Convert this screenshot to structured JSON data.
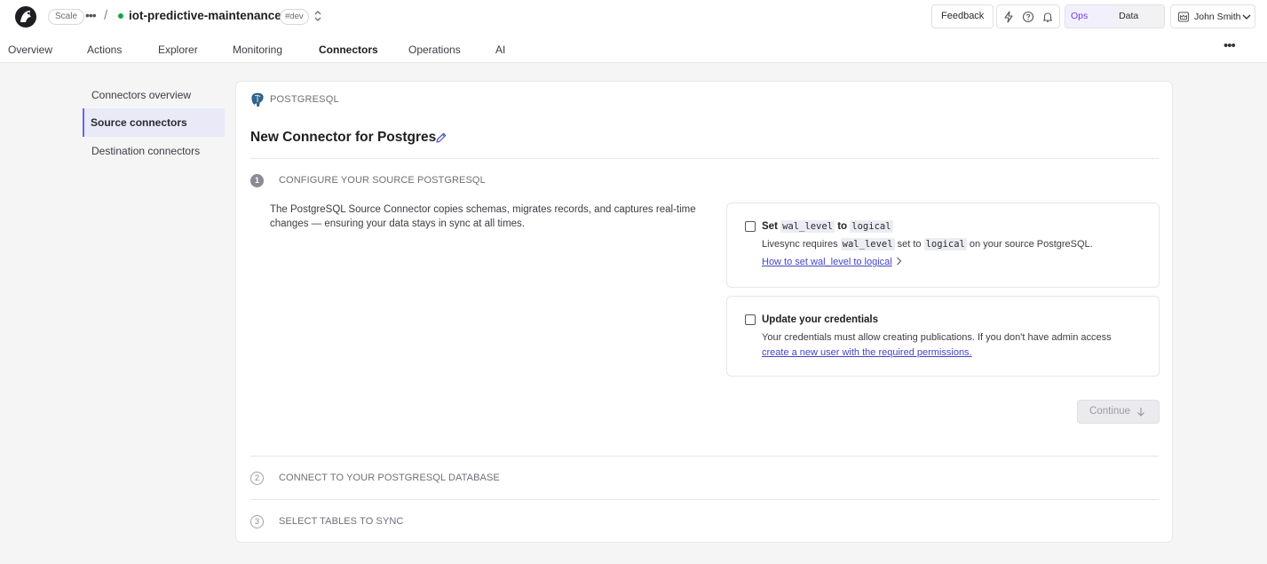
{
  "topbar": {
    "plan_badge": "Scale",
    "service_name": "iot-predictive-maintenance",
    "env_badge": "#dev",
    "feedback_label": "Feedback",
    "ops_view_label": "Ops view",
    "data_view_label": "Data view",
    "user_name": "John Smith",
    "status_color": "#16a34a",
    "accent_color": "#6d3de0"
  },
  "tabs": [
    {
      "label": "Overview"
    },
    {
      "label": "Actions"
    },
    {
      "label": "Explorer"
    },
    {
      "label": "Monitoring"
    },
    {
      "label": "Connectors",
      "active": true
    },
    {
      "label": "Operations"
    },
    {
      "label": "AI"
    }
  ],
  "sidenav": [
    {
      "label": "Connectors overview"
    },
    {
      "label": "Source connectors",
      "active": true
    },
    {
      "label": "Destination connectors"
    }
  ],
  "connector": {
    "source_type": "POSTGRESQL",
    "title": "New Connector for Postgres"
  },
  "steps": [
    {
      "number": "1",
      "title": "CONFIGURE YOUR SOURCE POSTGRESQL",
      "active": true
    },
    {
      "number": "2",
      "title": "CONNECT TO YOUR POSTGRESQL DATABASE"
    },
    {
      "number": "3",
      "title": "SELECT TABLES TO SYNC"
    }
  ],
  "step1": {
    "description": "The PostgreSQL Source Connector copies schemas, migrates records, and captures real-time changes — ensuring your data stays in sync at all times.",
    "wal_card": {
      "title_prefix": "Set",
      "title_code1": "wal_level",
      "title_middle": "to",
      "title_code2": "logical",
      "text_prefix": "Livesync requires",
      "text_code1": "wal_level",
      "text_middle": "set to",
      "text_code2": "logical",
      "text_suffix": "on your source PostgreSQL.",
      "link": "How to set wal_level to logical",
      "checked": false
    },
    "cred_card": {
      "title": "Update your credentials",
      "text": "Your credentials must allow creating publications. If you don't have admin access",
      "link": "create a new user with the required permissions.",
      "checked": false
    },
    "continue_label": "Continue"
  }
}
